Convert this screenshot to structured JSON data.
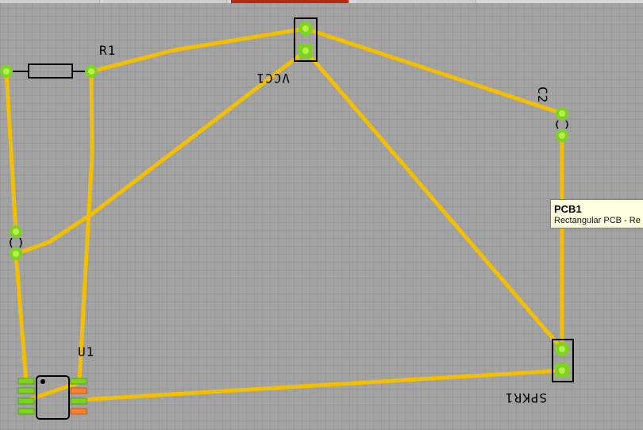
{
  "labels": {
    "r1": "R1",
    "vcc1": "VCC1",
    "c2": "C2",
    "u1": "U1",
    "spkr1": "SPKR1"
  },
  "tooltip": {
    "title": "PCB1",
    "description": "Rectangular PCB - Re"
  },
  "colors": {
    "board": "#a3a3a3",
    "trace": "#f2c000",
    "pad": "#7ed321",
    "pad_highlight": "#b8f04a",
    "smd_pad": "#ff7f2a",
    "silkscreen": "#000000",
    "active_tab": "#b22a14"
  }
}
